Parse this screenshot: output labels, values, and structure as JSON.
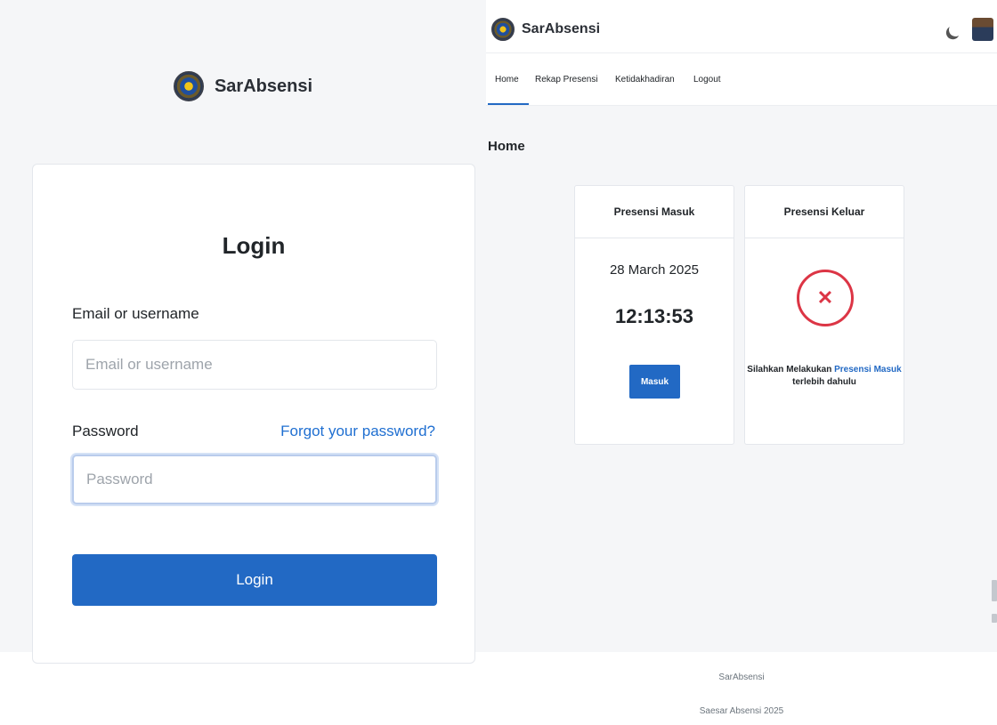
{
  "login": {
    "brand": "SarAbsensi",
    "title": "Login",
    "email_label": "Email or username",
    "email_placeholder": "Email or username",
    "password_label": "Password",
    "forgot_label": "Forgot your password?",
    "password_placeholder": "Password",
    "button_label": "Login"
  },
  "dashboard": {
    "brand": "SarAbsensi",
    "nav": [
      "Home",
      "Rekap Presensi",
      "Ketidakhadiran",
      "Logout"
    ],
    "active_nav": "Home",
    "page_title": "Home",
    "card_in": {
      "title": "Presensi Masuk",
      "date": "28 March 2025",
      "time": "12:13:53",
      "button_label": "Masuk"
    },
    "card_out": {
      "title": "Presensi Keluar",
      "status_icon": "x-circle-icon",
      "notice_prefix": "Silahkan Melakukan",
      "notice_link": "Presensi Masuk",
      "notice_suffix": "terlebih dahulu"
    },
    "footer_line1": "SarAbsensi",
    "footer_line2": "Saesar Absensi 2025"
  },
  "colors": {
    "primary": "#2269c4",
    "danger": "#dc3545",
    "background": "#f5f6f8"
  }
}
